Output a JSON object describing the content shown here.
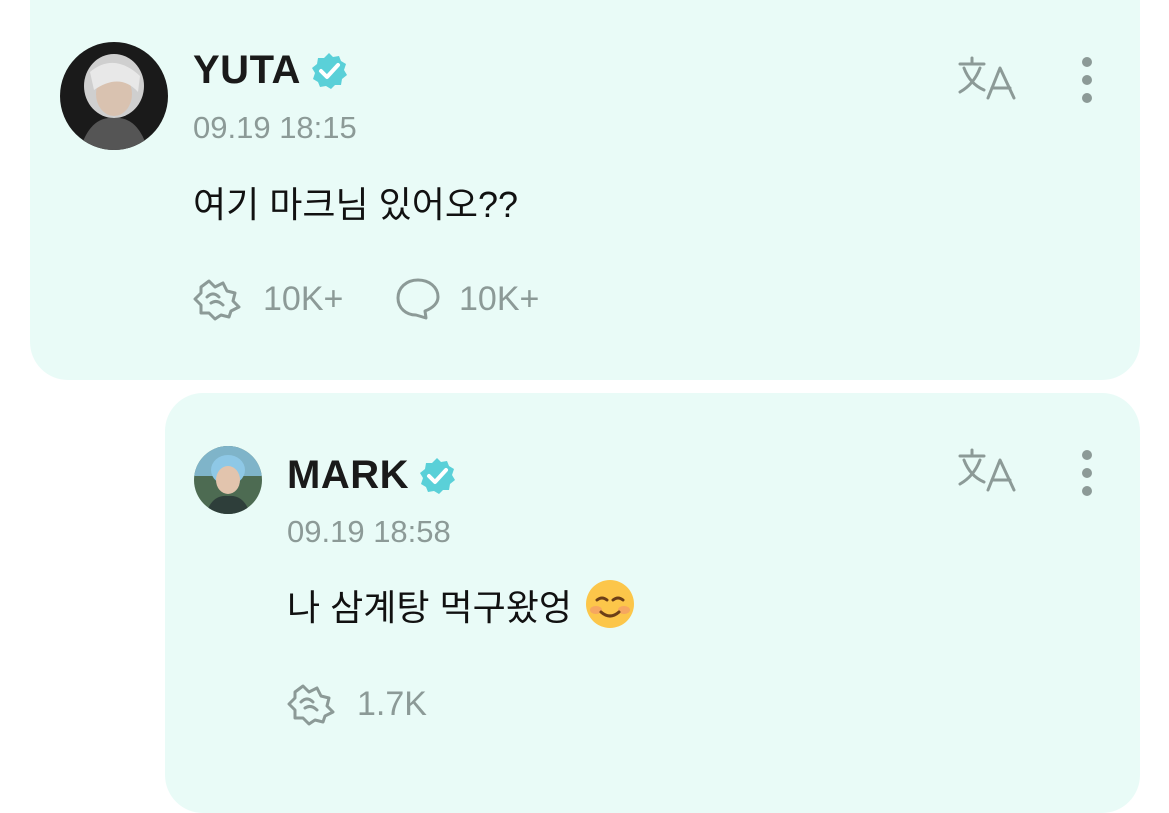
{
  "colors": {
    "card_bg": "#e9fbf7",
    "verified": "#5ad0d8",
    "muted": "#8c9a97",
    "text": "#111111"
  },
  "post": {
    "author": "YUTA",
    "timestamp": "09.19 18:15",
    "text": "여기 마크님 있어오??",
    "likes": "10K+",
    "comments": "10K+"
  },
  "reply": {
    "author": "MARK",
    "timestamp": "09.19 18:58",
    "text": "나 삼계탕 먹구왔엉",
    "emoji": "☺️",
    "likes": "1.7K"
  },
  "icons": {
    "translate": "translate-icon",
    "more": "more-vertical-icon",
    "like": "like-icon",
    "comment": "comment-icon",
    "verified": "verified-badge-icon"
  }
}
